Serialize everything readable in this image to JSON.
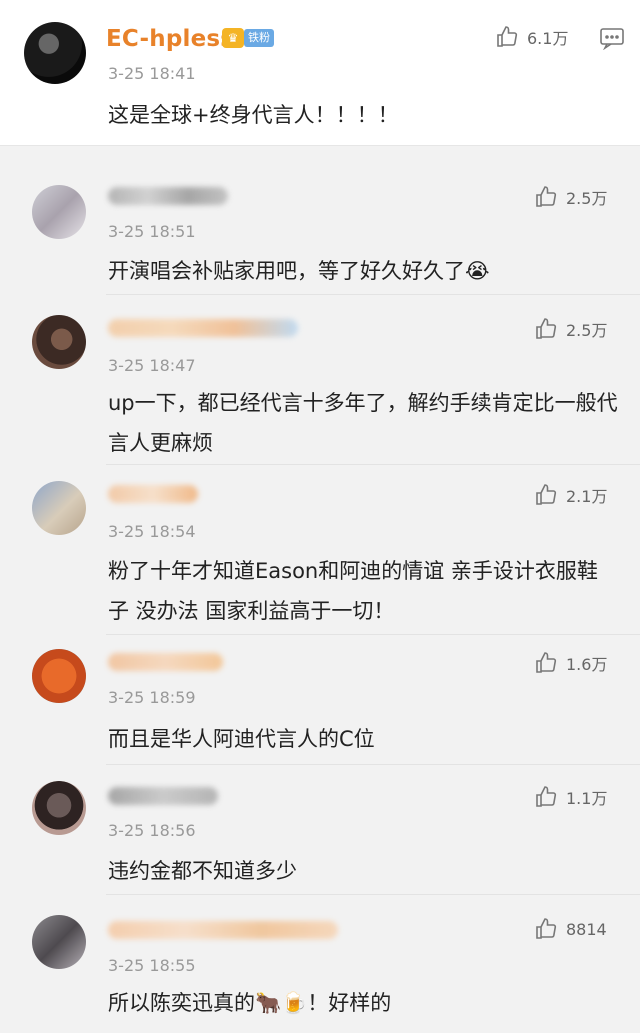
{
  "main_post": {
    "username": "EC-hpless",
    "fan_badge": "铁粉",
    "time": "3-25 18:41",
    "text": "这是全球+终身代言人！！！！",
    "likes": "6.1万"
  },
  "comments": [
    {
      "time": "3-25 18:51",
      "text": "开演唱会补贴家用吧，等了好久好久了😭",
      "likes": "2.5万"
    },
    {
      "time": "3-25 18:47",
      "text": "up一下，都已经代言十多年了，解约手续肯定比一般代言人更麻烦",
      "likes": "2.5万"
    },
    {
      "time": "3-25 18:54",
      "text": "粉了十年才知道Eason和阿迪的情谊 亲手设计衣服鞋子 没办法 国家利益高于一切！",
      "likes": "2.1万"
    },
    {
      "time": "3-25 18:59",
      "text": "而且是华人阿迪代言人的C位",
      "likes": "1.6万"
    },
    {
      "time": "3-25 18:56",
      "text": "违约金都不知道多少",
      "likes": "1.1万"
    },
    {
      "time": "3-25 18:55",
      "text": "所以陈奕迅真的🐂🍺！好样的",
      "likes": "8814"
    }
  ]
}
